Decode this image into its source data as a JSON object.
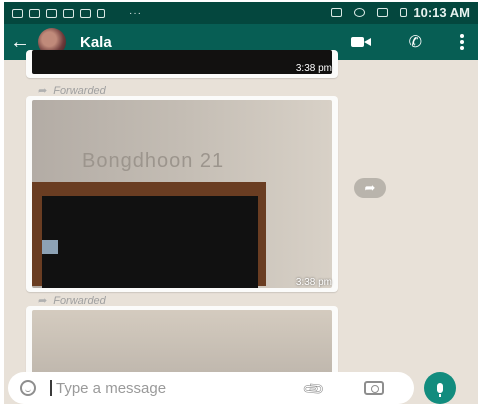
{
  "status_bar": {
    "time": "10:13 AM"
  },
  "header": {
    "back_icon": "arrow-left-icon",
    "contact_name": "Kala",
    "video_icon": "video-call-icon",
    "call_icon": "phone-icon",
    "menu_icon": "more-vert-icon"
  },
  "messages": [
    {
      "type": "image",
      "timestamp": "3:38 pm"
    },
    {
      "type": "image",
      "forwarded_label": "Forwarded",
      "wall_text": "Bongdhoon 21",
      "timestamp": "3:38 pm"
    },
    {
      "type": "image",
      "forwarded_label": "Forwarded"
    }
  ],
  "share_icon": "forward-share-icon",
  "input": {
    "placeholder": "Type a message",
    "emoji_icon": "emoji-icon",
    "attach_icon": "paperclip-icon",
    "camera_icon": "camera-icon",
    "mic_icon": "mic-icon"
  },
  "colors": {
    "status_bar": "#04473e",
    "app_bar": "#075e54",
    "mic_button": "#128c7e",
    "chat_background": "#e8e1d8"
  }
}
